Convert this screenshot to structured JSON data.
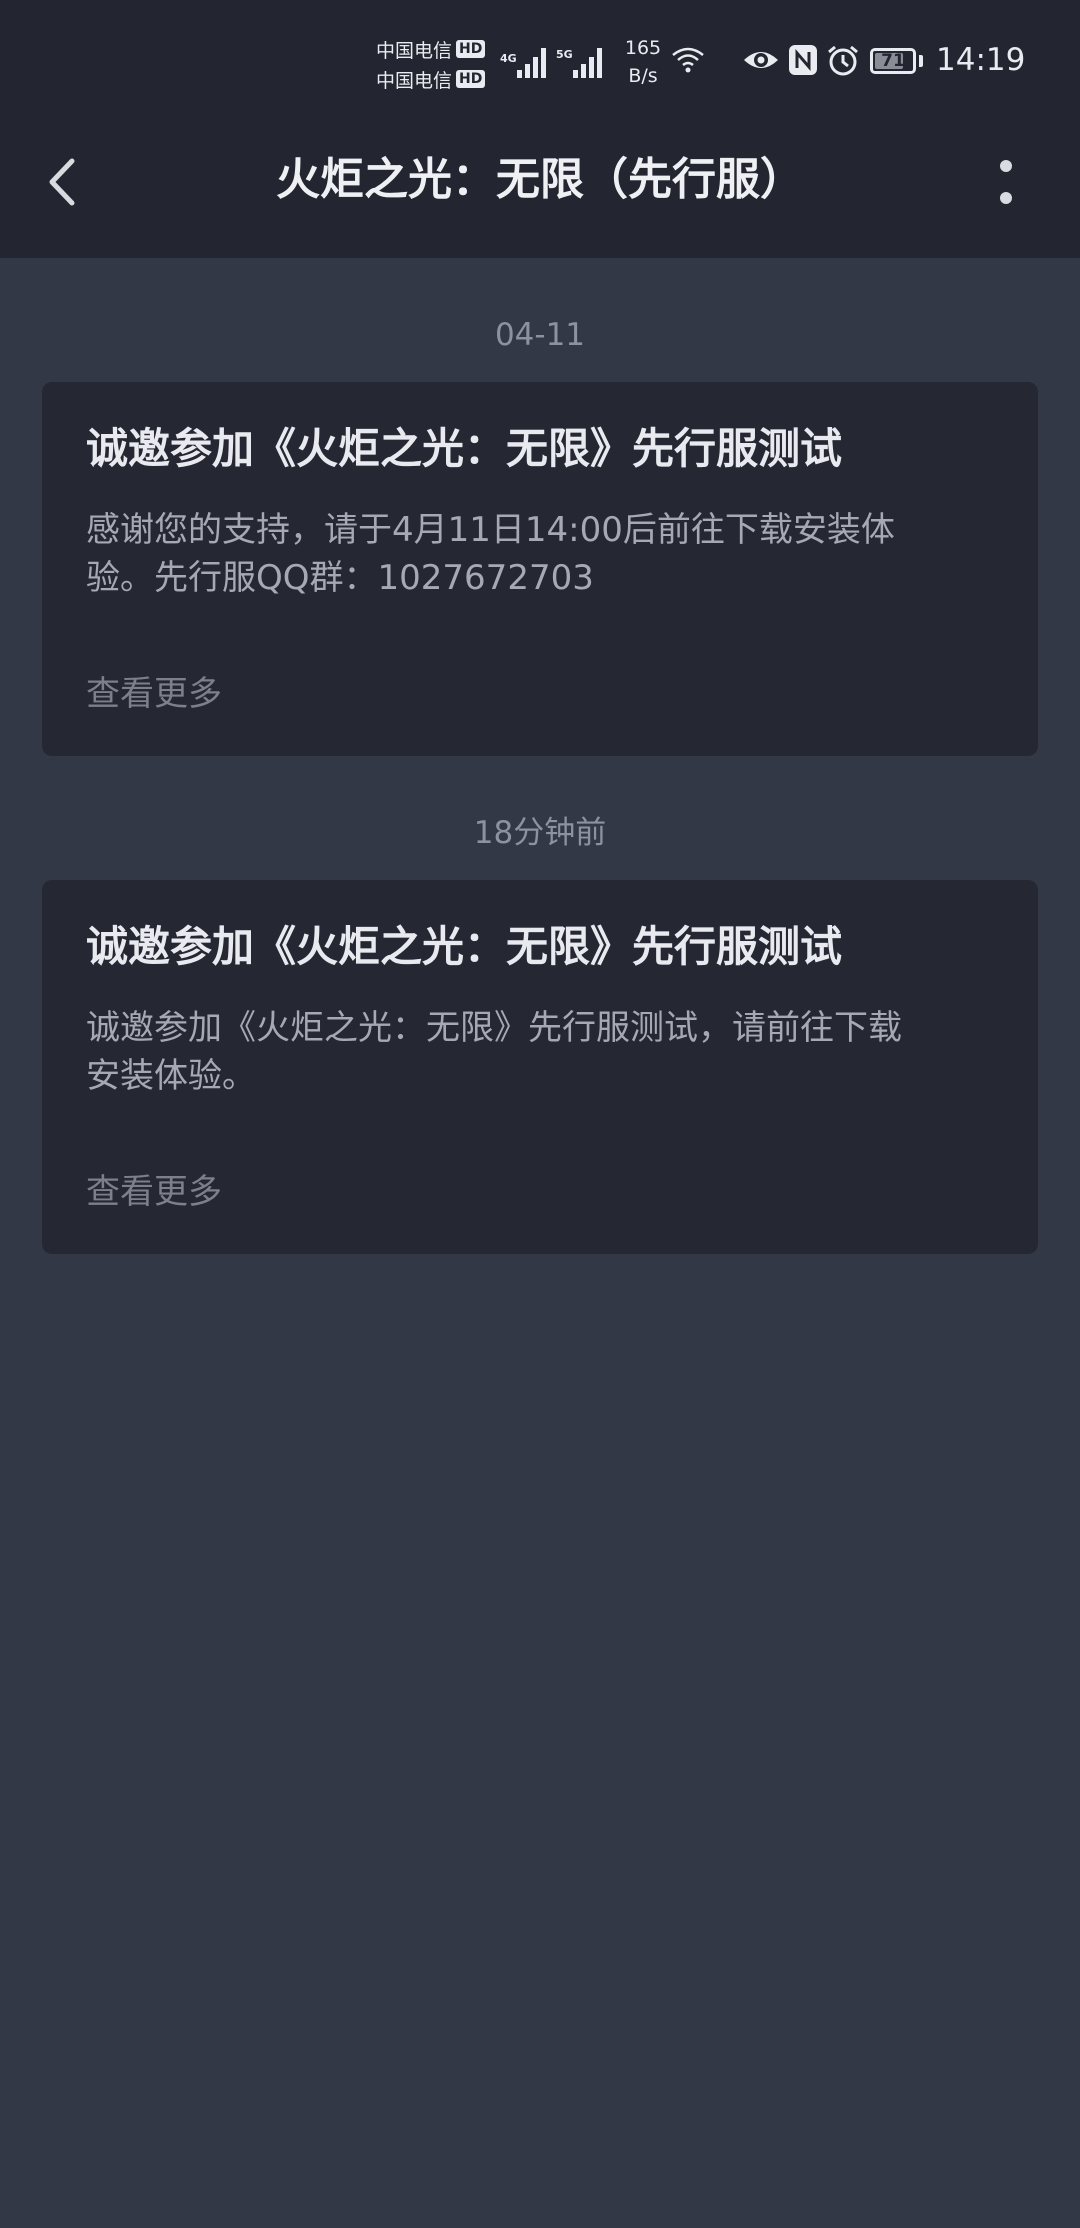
{
  "status_bar": {
    "carrier1": "中国电信",
    "carrier2": "中国电信",
    "hd_badge": "HD",
    "net1": "4G",
    "net2": "5G",
    "speed_value": "165",
    "speed_unit": "B/s",
    "battery": "71",
    "time": "14:19",
    "icons": [
      "signal-icon",
      "wifi-icon",
      "eye-icon",
      "nfc-icon",
      "alarm-icon",
      "battery-icon"
    ]
  },
  "header": {
    "title": "火炬之光：无限（先行服）",
    "back_icon": "back-arrow-icon",
    "more_icon": "more-vertical-icon"
  },
  "messages": [
    {
      "date": "04-11",
      "title": "诚邀参加《火炬之光：无限》先行服测试",
      "body_line1": "感谢您的支持，请于4月11日14:00后前往下载安装体",
      "body_line2": "验。先行服QQ群：1027672703",
      "more": "查看更多"
    },
    {
      "date": "18分钟前",
      "title": "诚邀参加《火炬之光：无限》先行服测试",
      "body_line1": "诚邀参加《火炬之光：无限》先行服测试，请前往下载",
      "body_line2": "安装体验。",
      "more": "查看更多"
    }
  ],
  "colors": {
    "background": "#333846",
    "header": "#232530",
    "card": "#252733",
    "title_text": "#e8eaef",
    "body_text": "#a6a9b3",
    "muted_text": "#7c808b"
  }
}
